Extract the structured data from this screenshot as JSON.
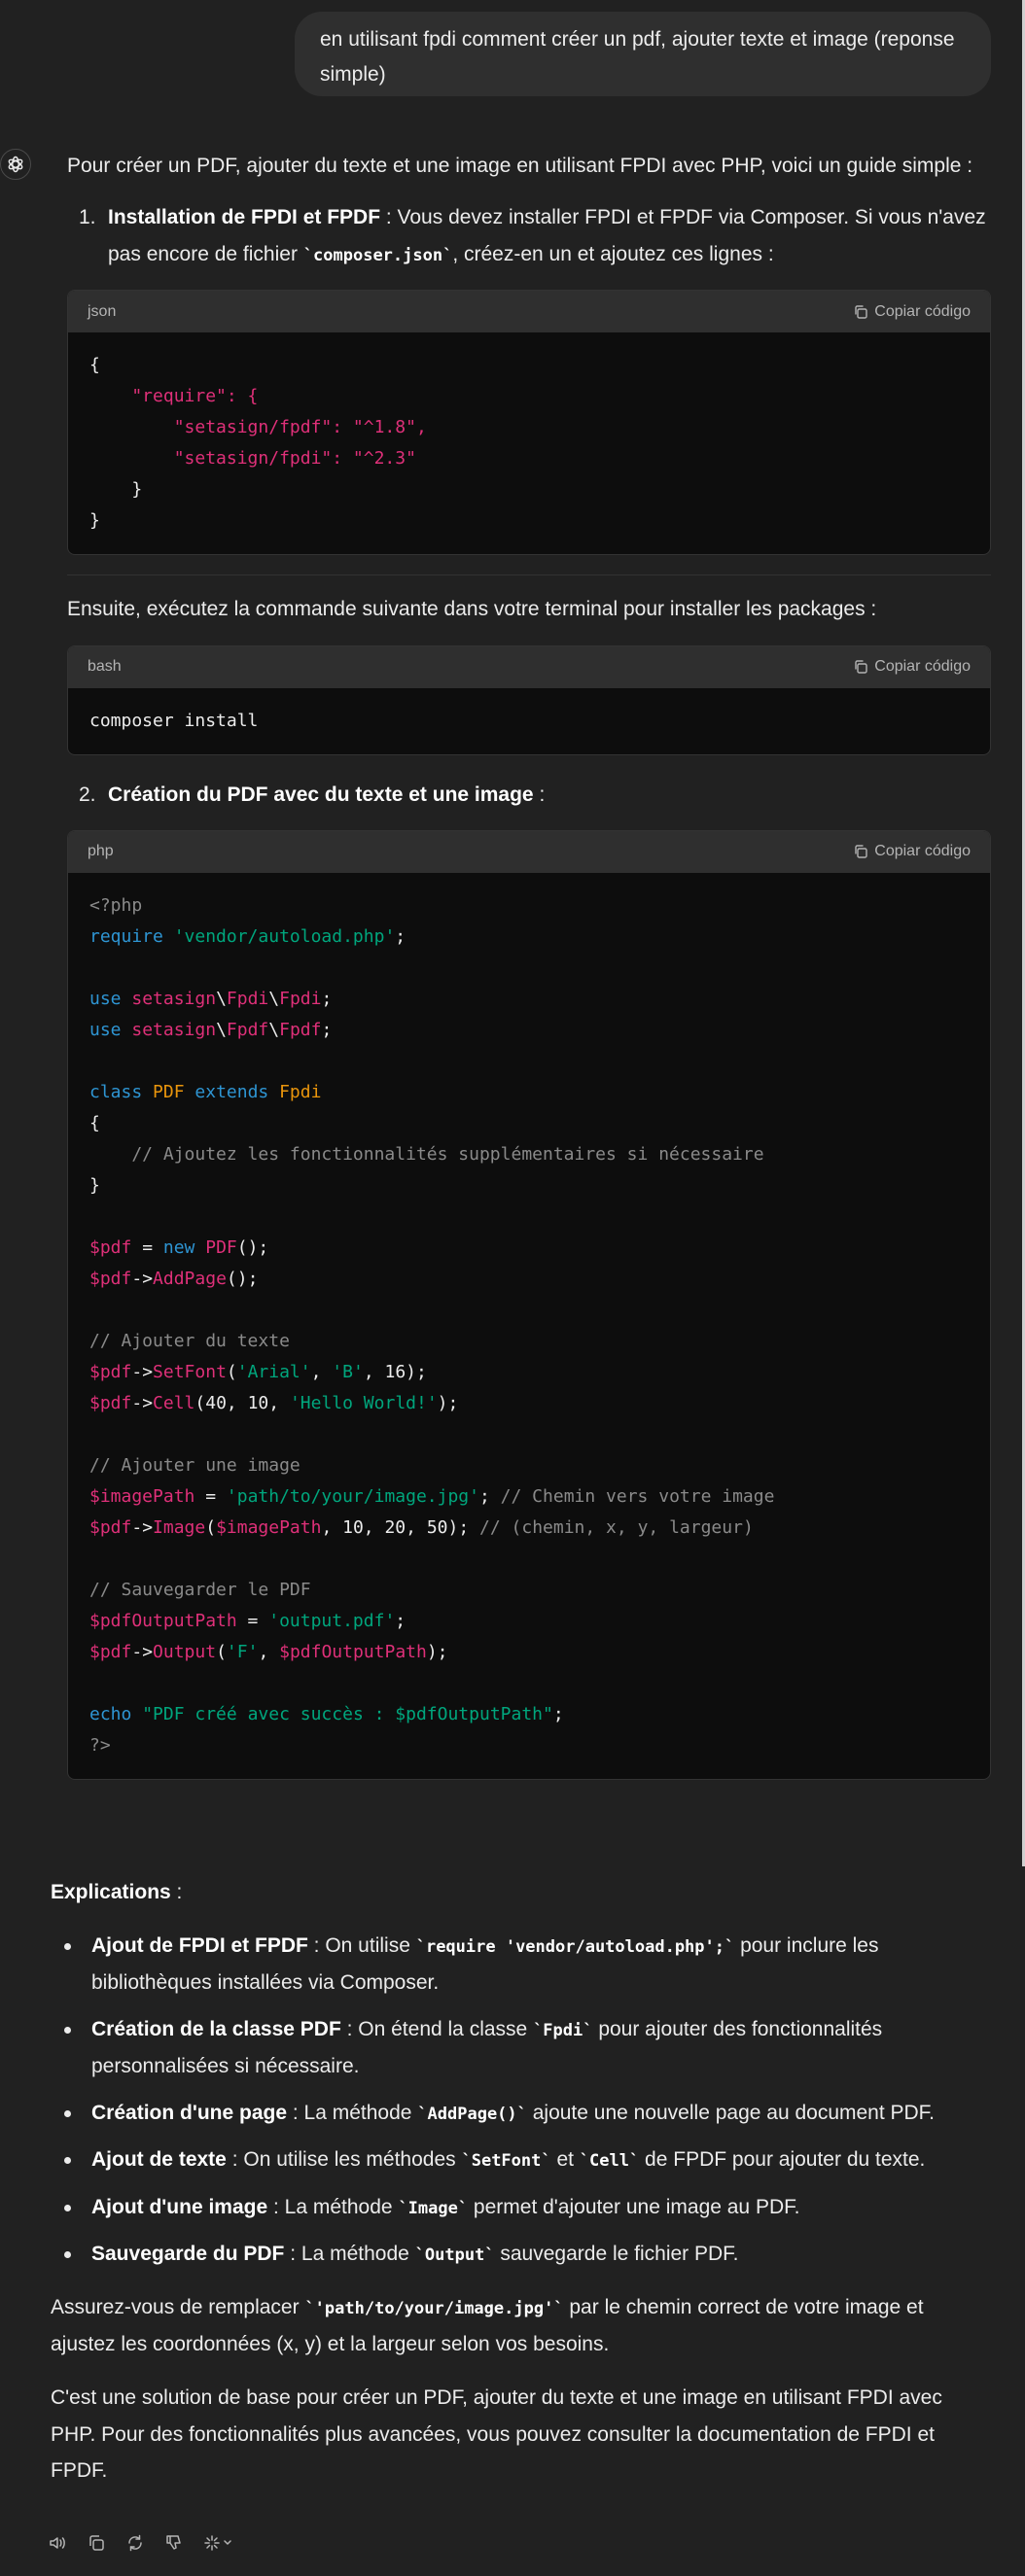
{
  "user_message": "en utilisant fpdi comment créer un pdf, ajouter texte et image (reponse simple)",
  "answer": {
    "intro": "Pour créer un PDF, ajouter du texte et une image en utilisant FPDI avec PHP, voici un guide simple :",
    "step1": {
      "num": "1.",
      "title": "Installation de FPDI et FPDF",
      "text_a": " : Vous devez installer FPDI et FPDF via Composer. Si vous n'avez pas encore de fichier ",
      "code": "`composer.json`",
      "text_b": ", créez-en un et ajoutez ces lignes :"
    },
    "code_json": {
      "lang": "json",
      "copy_label": "Copiar código",
      "lines": [
        "{",
        "    \"require\": {",
        "        \"setasign/fpdf\": \"^1.8\",",
        "        \"setasign/fpdi\": \"^2.3\"",
        "    }",
        "}"
      ]
    },
    "then_text": "Ensuite, exécutez la commande suivante dans votre terminal pour installer les packages :",
    "code_bash": {
      "lang": "bash",
      "copy_label": "Copiar código",
      "lines": [
        "composer install"
      ]
    },
    "step2": {
      "num": "2.",
      "title": "Création du PDF avec du texte et une image",
      "text": " :"
    },
    "code_php": {
      "lang": "php",
      "copy_label": "Copiar código",
      "lines": [
        "<?php",
        "require 'vendor/autoload.php';",
        "",
        "use setasign\\Fpdi\\Fpdi;",
        "use setasign\\Fpdf\\Fpdf;",
        "",
        "class PDF extends Fpdi",
        "{",
        "    // Ajoutez les fonctionnalités supplémentaires si nécessaire",
        "}",
        "",
        "$pdf = new PDF();",
        "$pdf->AddPage();",
        "",
        "// Ajouter du texte",
        "$pdf->SetFont('Arial', 'B', 16);",
        "$pdf->Cell(40, 10, 'Hello World!');",
        "",
        "// Ajouter une image",
        "$imagePath = 'path/to/your/image.jpg'; // Chemin vers votre image",
        "$pdf->Image($imagePath, 10, 20, 50); // (chemin, x, y, largeur)",
        "",
        "// Sauvegarder le PDF",
        "$pdfOutputPath = 'output.pdf';",
        "$pdf->Output('F', $pdfOutputPath);",
        "",
        "echo \"PDF créé avec succès : $pdfOutputPath\";",
        "?>"
      ]
    }
  },
  "explications": {
    "title": "Explications",
    "title_suffix": " :",
    "items": [
      {
        "bold": "Ajout de FPDI et FPDF",
        "a": " : On utilise ",
        "code": "`require 'vendor/autoload.php';`",
        "b": " pour inclure les bibliothèques installées via Composer."
      },
      {
        "bold": "Création de la classe PDF",
        "a": " : On étend la classe ",
        "code": "`Fpdi`",
        "b": " pour ajouter des fonctionnalités personnalisées si nécessaire."
      },
      {
        "bold": "Création d'une page",
        "a": " : La méthode ",
        "code": "`AddPage()`",
        "b": " ajoute une nouvelle page au document PDF."
      },
      {
        "bold": "Ajout de texte",
        "a": " : On utilise les méthodes ",
        "code": "`SetFont`",
        "mid": " et ",
        "code2": "`Cell`",
        "b": " de FPDF pour ajouter du texte."
      },
      {
        "bold": "Ajout d'une image",
        "a": " : La méthode ",
        "code": "`Image`",
        "b": " permet d'ajouter une image au PDF."
      },
      {
        "bold": "Sauvegarde du PDF",
        "a": " : La méthode ",
        "code": "`Output`",
        "b": " sauvegarde le fichier PDF."
      }
    ],
    "para1_a": "Assurez-vous de remplacer ",
    "para1_code": "`'path/to/your/image.jpg'`",
    "para1_b": " par le chemin correct de votre image et ajustez les coordonnées (x, y) et la largeur selon vos besoins.",
    "para2": "C'est une solution de base pour créer un PDF, ajouter du texte et une image en utilisant FPDI avec PHP. Pour des fonctionnalités plus avancées, vous pouvez consulter la documentation de FPDI et FPDF."
  },
  "actions": [
    "read-aloud-icon",
    "copy-icon",
    "regenerate-icon",
    "thumbs-down-icon",
    "model-switch-icon"
  ],
  "colors": {
    "background": "#212121",
    "bubble": "#2f2f2f",
    "code_bg": "#0d0d0d",
    "keyword": "#2e95d3",
    "string": "#00a67d",
    "attr": "#df3079",
    "type": "#e9950c"
  }
}
